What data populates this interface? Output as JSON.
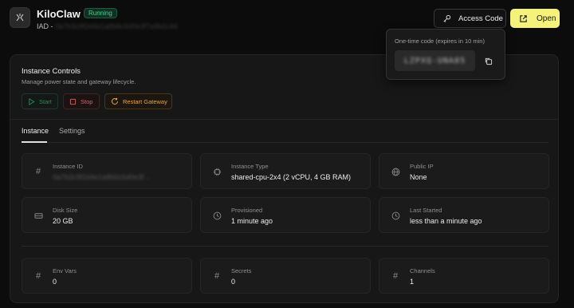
{
  "header": {
    "app_name": "KiloClaw",
    "status": "Running",
    "region": "IAD",
    "region_separator": " - ",
    "instance_host": "0a7b3c9f2d4e1a8b6c5d0e3f7a9b2c4d"
  },
  "actions": {
    "access_code_label": "Access Code",
    "open_label": "Open"
  },
  "popover": {
    "title": "One-time code (expires in 10 min)",
    "code": "LZPXQ-UNA85"
  },
  "controls": {
    "title": "Instance Controls",
    "description": "Manage power state and gateway lifecycle.",
    "start_label": "Start",
    "stop_label": "Stop",
    "restart_label": "Restart Gateway"
  },
  "tabs": [
    {
      "label": "Instance",
      "active": true
    },
    {
      "label": "Settings",
      "active": false
    }
  ],
  "details": [
    {
      "label": "Instance ID",
      "value": "0a7b3c9f2d4e1a8b6c5d0e3f…",
      "icon": "hash-icon"
    },
    {
      "label": "Instance Type",
      "value": "shared-cpu-2x4 (2 vCPU, 4 GB RAM)",
      "icon": "cpu-icon"
    },
    {
      "label": "Public IP",
      "value": "None",
      "icon": "globe-icon"
    },
    {
      "label": "Disk Size",
      "value": "20 GB",
      "icon": "disk-icon"
    },
    {
      "label": "Provisioned",
      "value": "1 minute ago",
      "icon": "clock-icon"
    },
    {
      "label": "Last Started",
      "value": "less than a minute ago",
      "icon": "clock-icon"
    }
  ],
  "stats": [
    {
      "label": "Env Vars",
      "value": "0",
      "icon": "hash-icon"
    },
    {
      "label": "Secrets",
      "value": "0",
      "icon": "hash-icon"
    },
    {
      "label": "Channels",
      "value": "1",
      "icon": "hash-icon"
    }
  ],
  "colors": {
    "accent": "#f4f27a",
    "running": "#3fd48a",
    "stop": "#e06060",
    "restart": "#e9a23b"
  }
}
